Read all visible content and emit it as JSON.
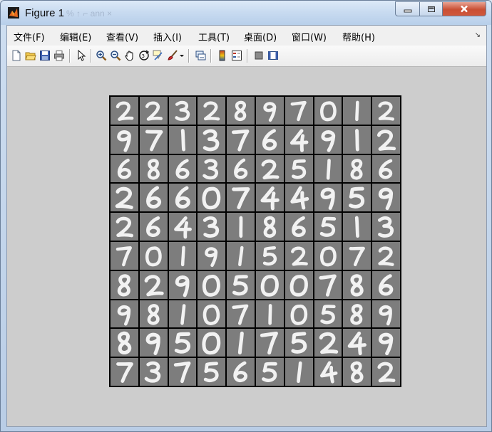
{
  "window": {
    "title": "Figure 1",
    "ghost_title": "% ↑ ⌐ ann ×"
  },
  "menu": {
    "items": [
      "文件(F)",
      "编辑(E)",
      "查看(V)",
      "插入(I)",
      "工具(T)",
      "桌面(D)",
      "窗口(W)",
      "帮助(H)"
    ]
  },
  "toolbar": {
    "icons": [
      "new-figure-icon",
      "open-file-icon",
      "save-icon",
      "print-icon",
      "pointer-icon",
      "zoom-in-icon",
      "zoom-out-icon",
      "pan-icon",
      "rotate-3d-icon",
      "data-cursor-icon",
      "brush-icon",
      "brush-dropdown-icon",
      "link-plot-icon",
      "colorbar-icon",
      "legend-icon",
      "hide-plot-tools-icon",
      "show-plot-tools-icon"
    ]
  },
  "digits": [
    [
      2,
      2,
      3,
      2,
      8,
      9,
      7,
      0,
      1,
      2
    ],
    [
      9,
      7,
      1,
      3,
      7,
      6,
      4,
      9,
      1,
      2
    ],
    [
      6,
      8,
      6,
      3,
      6,
      2,
      5,
      1,
      8,
      6
    ],
    [
      2,
      6,
      6,
      0,
      7,
      4,
      4,
      9,
      5,
      9
    ],
    [
      2,
      6,
      4,
      3,
      1,
      8,
      6,
      5,
      1,
      3
    ],
    [
      7,
      0,
      1,
      9,
      1,
      5,
      2,
      0,
      7,
      2
    ],
    [
      8,
      2,
      9,
      0,
      5,
      0,
      0,
      7,
      8,
      6
    ],
    [
      9,
      8,
      1,
      0,
      7,
      1,
      0,
      5,
      8,
      9
    ],
    [
      8,
      9,
      5,
      0,
      1,
      7,
      5,
      2,
      4,
      9
    ],
    [
      7,
      3,
      7,
      5,
      6,
      5,
      1,
      4,
      8,
      2
    ]
  ],
  "colors": {
    "cell_bg": "#7d7d7d",
    "stroke": "#f2f2f2",
    "figure_bg": "#cdcdcd"
  }
}
